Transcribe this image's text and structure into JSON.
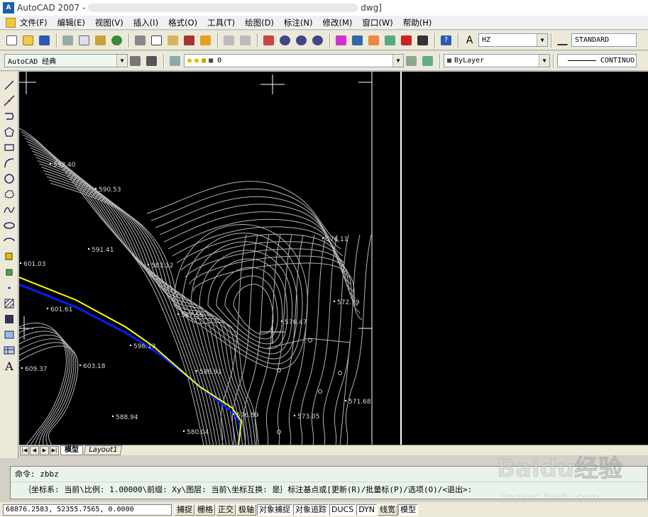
{
  "window": {
    "app_title": "AutoCAD 2007 -",
    "doc_suffix": "dwg]"
  },
  "menu": [
    "文件(F)",
    "编辑(E)",
    "视图(V)",
    "插入(I)",
    "格式(O)",
    "工具(T)",
    "绘图(D)",
    "标注(N)",
    "修改(M)",
    "窗口(W)",
    "帮助(H)"
  ],
  "toolbar": {
    "text_style": "HZ",
    "dim_style": "STANDARD",
    "workspace": "AutoCAD 经典",
    "layer_name": "0",
    "color": "ByLayer",
    "linetype": "CONTINUO"
  },
  "labels": [
    {
      "text": "593.40"
    },
    {
      "text": "590.53"
    },
    {
      "text": "591.41"
    },
    {
      "text": "583.12"
    },
    {
      "text": "576.11"
    },
    {
      "text": "572.79"
    },
    {
      "text": "587.58"
    },
    {
      "text": "576.47"
    },
    {
      "text": "596.13"
    },
    {
      "text": "601.03"
    },
    {
      "text": "601.61"
    },
    {
      "text": "603.18"
    },
    {
      "text": "609.37"
    },
    {
      "text": "588.94"
    },
    {
      "text": "576.89"
    },
    {
      "text": "573.05"
    },
    {
      "text": "571.68"
    },
    {
      "text": "580.04"
    },
    {
      "text": "586.91"
    }
  ],
  "tabs": {
    "model": "模型",
    "layout1": "Layout1"
  },
  "command": {
    "line1": "命令: zbbz",
    "line2": "｛坐标系: 当前\\比例: 1.00000\\前缀: Xy\\图层: 当前\\坐标互换: 是｝标注基点或[更新(R)/批量标(P)/选项(O)/<退出>:"
  },
  "status": {
    "coords": "68876.2583, 52355.7565, 0.0000",
    "buttons": [
      "捕捉",
      "栅格",
      "正交",
      "极轴",
      "对象捕捉",
      "对象追踪",
      "DUCS",
      "DYN",
      "线宽",
      "模型"
    ]
  },
  "watermark": {
    "brand": "Baidu经验",
    "url": "jingyan.baidu.com"
  },
  "colors": {
    "boundary_yellow": "#ffff00",
    "boundary_blue": "#0020ff",
    "contour": "#b4b4b4",
    "canvas": "#000000"
  }
}
